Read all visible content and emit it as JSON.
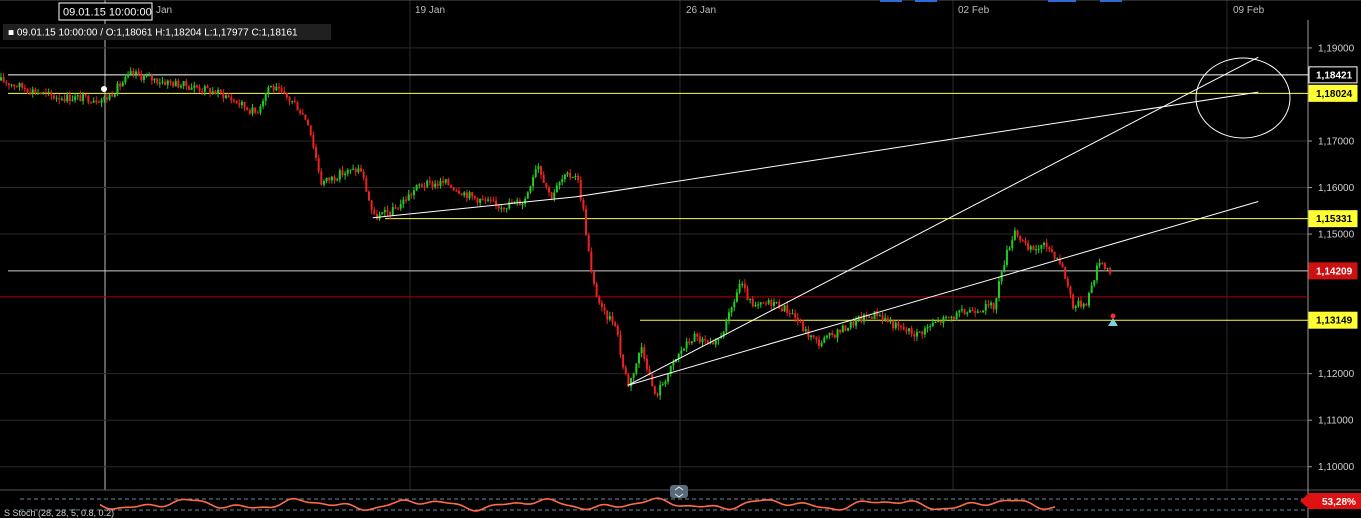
{
  "chart_data": {
    "type": "candlestick",
    "instrument_info": {
      "ohlc_text": "■ 09.01.15 10:00:00 / O:1,18061  H:1,18204  L:1,17977  C:1,18161",
      "cursor_time": "09.01.15 10:00:00"
    },
    "x_axis": {
      "labels": [
        "Jan",
        "19 Jan",
        "26 Jan",
        "02 Feb",
        "09 Feb"
      ]
    },
    "y_axis": {
      "range": [
        1.095,
        1.196
      ],
      "ticks": [
        {
          "label": "1,19000",
          "value": 1.19
        },
        {
          "label": "1,17000",
          "value": 1.17
        },
        {
          "label": "1,16000",
          "value": 1.16
        },
        {
          "label": "1,15000",
          "value": 1.15
        },
        {
          "label": "1,12000",
          "value": 1.12
        },
        {
          "label": "1,11000",
          "value": 1.11
        },
        {
          "label": "1,10000",
          "value": 1.1
        }
      ]
    },
    "levels": [
      {
        "label": "1,18421",
        "value": 1.18421,
        "color": "#ffffff",
        "bg": "#000000",
        "fg": "#ffffff"
      },
      {
        "label": "1,18024",
        "value": 1.18024,
        "color": "#ffff33",
        "bg": "#ffff33",
        "fg": "#000000"
      },
      {
        "label": "1,15331",
        "value": 1.15331,
        "color": "#ffff33",
        "bg": "#ffff33",
        "fg": "#000000"
      },
      {
        "label": "1,14209",
        "value": 1.14209,
        "color": "#cccccc",
        "bg": "#cc1111",
        "fg": "#ffffff"
      },
      {
        "label": "1,13149",
        "value": 1.13149,
        "color": "#ffff33",
        "bg": "#ffff33",
        "fg": "#000000"
      }
    ],
    "current_price_line": {
      "value": 1.1365,
      "color": "#b00000"
    },
    "trendlines": [
      {
        "x1": 0.285,
        "y1": 1.1535,
        "x2": 0.44,
        "y2": 1.158
      },
      {
        "x1": 0.44,
        "y1": 1.158,
        "x2": 0.962,
        "y2": 1.1805
      },
      {
        "x1": 0.48,
        "y1": 1.1175,
        "x2": 0.962,
        "y2": 1.188
      },
      {
        "x1": 0.48,
        "y1": 1.1175,
        "x2": 0.962,
        "y2": 1.157
      }
    ],
    "key_points": [
      [
        0.0,
        1.183
      ],
      [
        0.04,
        1.1795
      ],
      [
        0.08,
        1.179
      ],
      [
        0.1,
        1.1845
      ],
      [
        0.12,
        1.183
      ],
      [
        0.15,
        1.1815
      ],
      [
        0.17,
        1.18
      ],
      [
        0.195,
        1.176
      ],
      [
        0.205,
        1.182
      ],
      [
        0.225,
        1.178
      ],
      [
        0.235,
        1.174
      ],
      [
        0.245,
        1.161
      ],
      [
        0.26,
        1.163
      ],
      [
        0.275,
        1.164
      ],
      [
        0.285,
        1.1535
      ],
      [
        0.3,
        1.155
      ],
      [
        0.32,
        1.1605
      ],
      [
        0.34,
        1.161
      ],
      [
        0.36,
        1.158
      ],
      [
        0.38,
        1.156
      ],
      [
        0.4,
        1.157
      ],
      [
        0.41,
        1.1655
      ],
      [
        0.42,
        1.158
      ],
      [
        0.43,
        1.162
      ],
      [
        0.44,
        1.163
      ],
      [
        0.445,
        1.1555
      ],
      [
        0.452,
        1.14
      ],
      [
        0.46,
        1.133
      ],
      [
        0.47,
        1.131
      ],
      [
        0.475,
        1.122
      ],
      [
        0.48,
        1.1175
      ],
      [
        0.49,
        1.126
      ],
      [
        0.5,
        1.115
      ],
      [
        0.51,
        1.12
      ],
      [
        0.52,
        1.125
      ],
      [
        0.53,
        1.128
      ],
      [
        0.545,
        1.1255
      ],
      [
        0.555,
        1.131
      ],
      [
        0.565,
        1.1395
      ],
      [
        0.575,
        1.134
      ],
      [
        0.59,
        1.1355
      ],
      [
        0.605,
        1.133
      ],
      [
        0.615,
        1.129
      ],
      [
        0.625,
        1.1265
      ],
      [
        0.64,
        1.129
      ],
      [
        0.655,
        1.1315
      ],
      [
        0.67,
        1.133
      ],
      [
        0.685,
        1.13
      ],
      [
        0.7,
        1.1285
      ],
      [
        0.715,
        1.131
      ],
      [
        0.73,
        1.1325
      ],
      [
        0.745,
        1.134
      ],
      [
        0.76,
        1.1345
      ],
      [
        0.765,
        1.1425
      ],
      [
        0.775,
        1.151
      ],
      [
        0.785,
        1.1465
      ],
      [
        0.8,
        1.1475
      ],
      [
        0.81,
        1.144
      ],
      [
        0.815,
        1.1395
      ],
      [
        0.82,
        1.1345
      ],
      [
        0.83,
        1.1355
      ],
      [
        0.84,
        1.1445
      ],
      [
        0.848,
        1.142
      ]
    ],
    "stoch_label": "S Stoch (28, 28, 5, 0.8, 0.2)",
    "stoch_value": "53,28%",
    "colors": {
      "up": "#22cc22",
      "down": "#ee2222",
      "grid": "#2a2a2a",
      "axis": "#9a9a9a",
      "trendline": "#ffffff",
      "stoch": "#ff6a4a",
      "stoch_flag": "#dd1111"
    }
  }
}
